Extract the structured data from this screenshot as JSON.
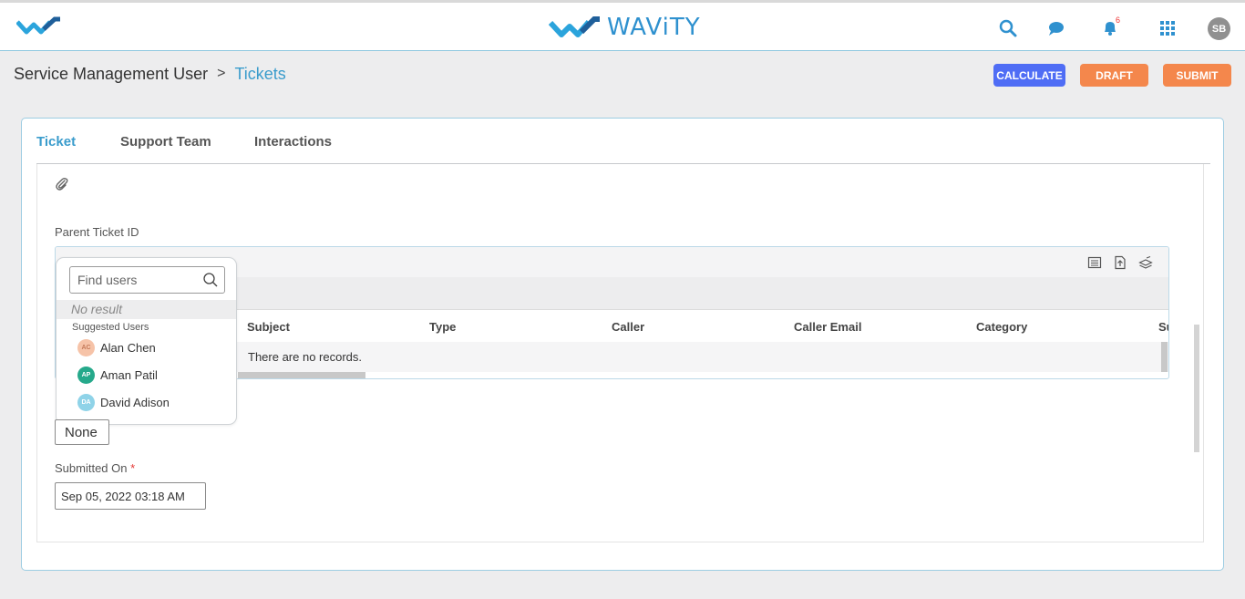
{
  "header": {
    "brand_name": "WAViTY",
    "notification_count": "6",
    "user_initials": "SB"
  },
  "breadcrumb": {
    "parent": "Service Management User",
    "separator": ">",
    "current": "Tickets"
  },
  "actions": {
    "calculate": "CALCULATE",
    "draft": "DRAFT",
    "submit": "SUBMIT"
  },
  "tabs": [
    {
      "label": "Ticket",
      "active": true
    },
    {
      "label": "Support Team",
      "active": false
    },
    {
      "label": "Interactions",
      "active": false
    }
  ],
  "form": {
    "parent_ticket_label": "Parent Ticket ID",
    "none_value": "None",
    "submitted_on_label": "Submitted On",
    "required_mark": "*",
    "submitted_on_value": "Sep 05, 2022 03:18 AM"
  },
  "grid": {
    "columns": [
      "Subject",
      "Type",
      "Caller",
      "Caller Email",
      "Category",
      "Su"
    ],
    "empty_message": "There are no records."
  },
  "user_picker": {
    "placeholder": "Find users",
    "no_result": "No result",
    "suggested_heading": "Suggested Users",
    "users": [
      {
        "initials": "AC",
        "name": "Alan Chen",
        "color": "#f6c3a8"
      },
      {
        "initials": "AP",
        "name": "Aman Patil",
        "color": "#26a98b"
      },
      {
        "initials": "DA",
        "name": "David Adison",
        "color": "#8fd3e8"
      }
    ]
  },
  "colors": {
    "accent": "#3a9ccc",
    "calculate": "#4f6df5",
    "draft_submit": "#f4874c"
  }
}
